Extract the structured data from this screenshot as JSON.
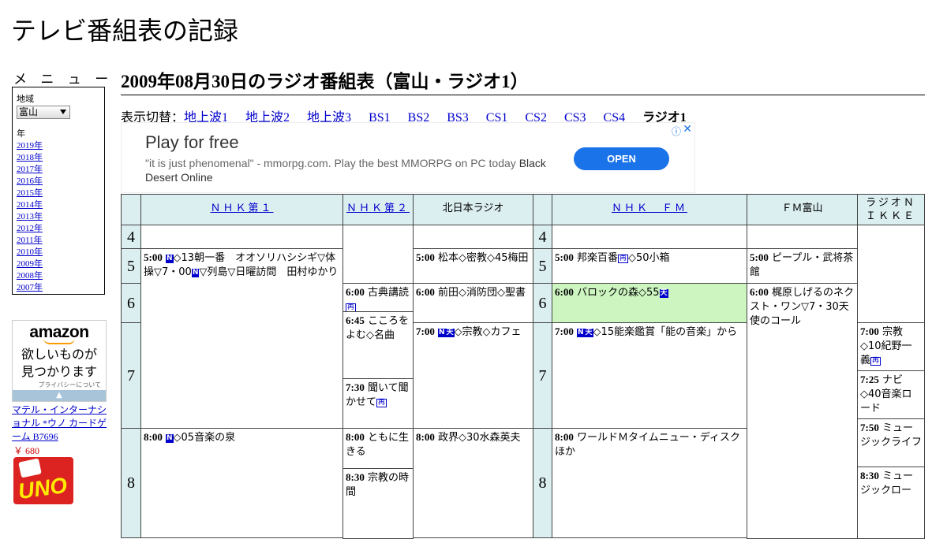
{
  "site": {
    "title": "テレビ番組表の記録"
  },
  "menu": {
    "heading": "メ ニ ュ ー",
    "region_label": "地域",
    "region_value": "富山",
    "year_label": "年",
    "years": [
      "2019年",
      "2018年",
      "2017年",
      "2016年",
      "2015年",
      "2014年",
      "2013年",
      "2012年",
      "2011年",
      "2010年",
      "2009年",
      "2008年",
      "2007年"
    ]
  },
  "sidebar_ad": {
    "logo": "amazon",
    "text_line1": "欲しいものが",
    "text_line2": "見つかります",
    "privacy": "プライバシーについて",
    "product_link": "マテル・インターナショナル *ウノ カードゲーム B7696",
    "price": "￥ 680",
    "product_image_text": "UNO"
  },
  "page": {
    "title": "2009年08月30日のラジオ番組表（富山・ラジオ1）",
    "switch_label": "表示切替：",
    "switch_links": [
      "地上波1",
      "地上波2",
      "地上波3",
      "BS1",
      "BS2",
      "BS3",
      "CS1",
      "CS2",
      "CS3",
      "CS4"
    ],
    "switch_current": "ラジオ1"
  },
  "ad_banner": {
    "title": "Play for free",
    "desc": "\"it is just phenomenal\" - mmorpg.com. Play the best MMORPG on PC today",
    "desc_brand": "Black Desert Online",
    "button": "OPEN",
    "info_icon": "info-icon",
    "close_icon": "close-icon"
  },
  "schedule": {
    "channels": [
      "ＮＨＫ第１",
      "ＮＨＫ第２",
      "北日本ラジオ",
      "ＮＨＫ　ＦＭ",
      "ＦＭ富山",
      "ラジオＮＩＫＫＥＩ"
    ],
    "hours": [
      "4",
      "5",
      "6",
      "7",
      "8"
    ],
    "programs": {
      "nhk1_500_time": "5:00",
      "nhk1_500_a": "◇13朝一番　オオソリハシシギ▽体操▽7・00",
      "nhk1_500_b": "▽列島▽日曜訪問　田村ゆかり",
      "nhk1_800_time": "8:00",
      "nhk1_800": "◇05音楽の泉",
      "nhk2_600_time": "6:00",
      "nhk2_600": "古典講読",
      "nhk2_645_time": "6:45",
      "nhk2_645": "こころをよむ◇名曲",
      "nhk2_730_time": "7:30",
      "nhk2_730": "聞いて聞かせて",
      "nhk2_800_time": "8:00",
      "nhk2_800": "ともに生きる",
      "nhk2_830_time": "8:30",
      "nhk2_830": "宗教の時間",
      "knb_500_time": "5:00",
      "knb_500": "松本◇密教◇45梅田",
      "knb_600_time": "6:00",
      "knb_600": "前田◇消防団◇聖書",
      "knb_700_time": "7:00",
      "knb_700": "◇宗教◇カフェ",
      "knb_800_time": "8:00",
      "knb_800": "政界◇30水森英夫",
      "fm_500_time": "5:00",
      "fm_500": "邦楽百番",
      "fm_500_b": "◇50小箱",
      "fm_600_time": "6:00",
      "fm_600": "バロックの森◇55",
      "fm_700_time": "7:00",
      "fm_700": "◇15能楽鑑賞「能の音楽」から",
      "fm_800_time": "8:00",
      "fm_800": "ワールドＭタイムニュー・ディスクほか",
      "fmt_500_time": "5:00",
      "fmt_500": "ピープル・武将茶館",
      "fmt_600_time": "6:00",
      "fmt_600": "梶原しげるのネクスト・ワン▽7・30天使のコール",
      "nikkei_700_time": "7:00",
      "nikkei_700": "宗教◇10紀野一義",
      "nikkei_725_time": "7:25",
      "nikkei_725": "ナビ◇40音楽ロード",
      "nikkei_750_time": "7:50",
      "nikkei_750": "ミュージックライフ",
      "nikkei_830_time": "8:30",
      "nikkei_830": "ミュージックロー"
    },
    "marks": {
      "n": "N",
      "ten": "天",
      "sai": "再"
    }
  }
}
